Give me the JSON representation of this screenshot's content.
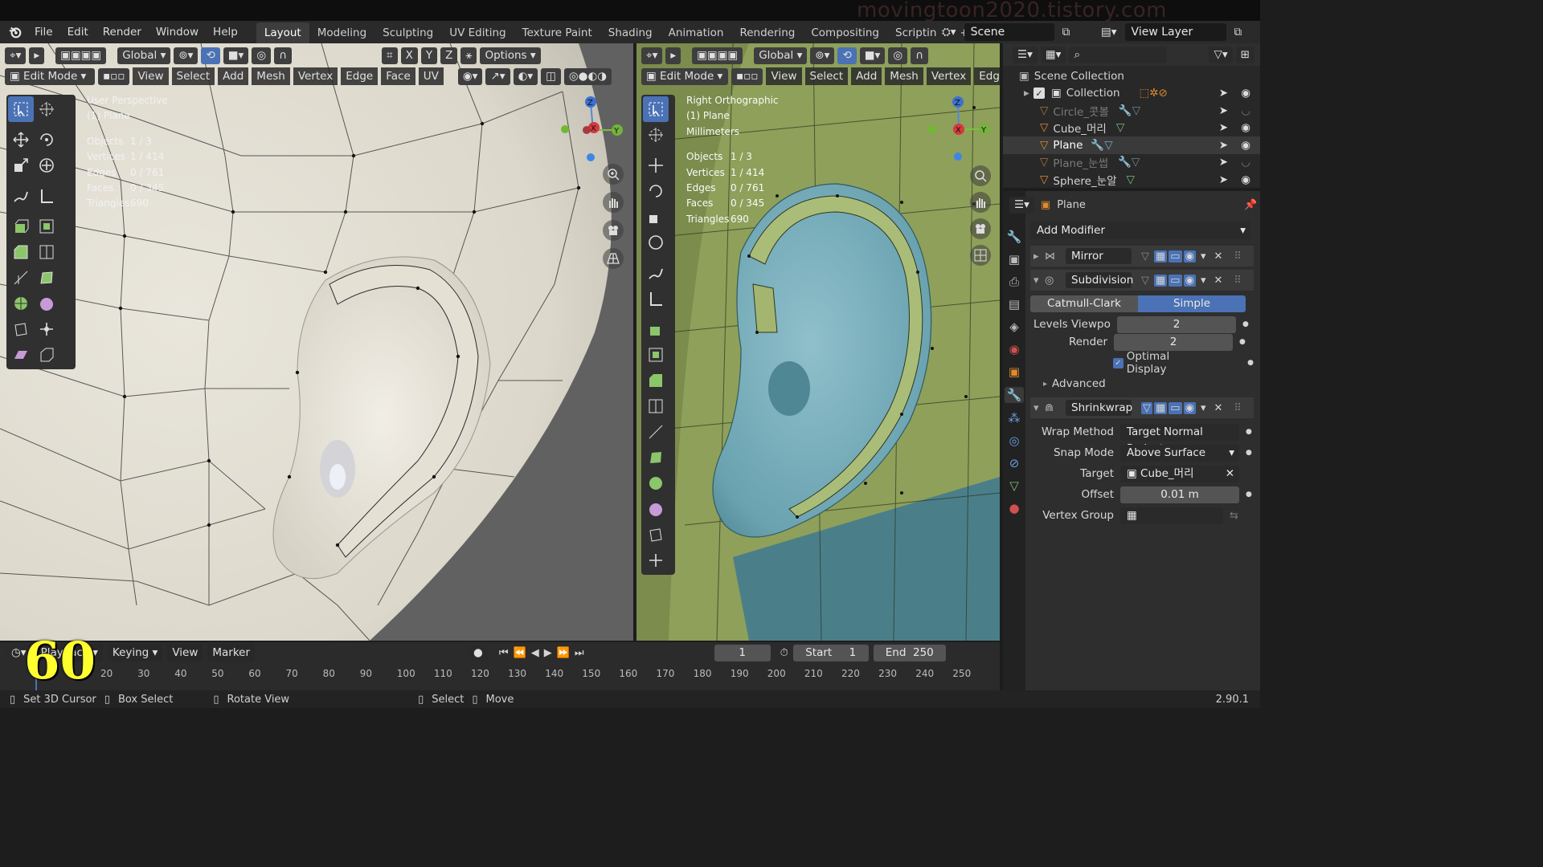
{
  "app": {
    "version": "2.90.1",
    "watermark": "movingtoon2020.tistory.com",
    "overlay_number": "60"
  },
  "menu": [
    "File",
    "Edit",
    "Render",
    "Window",
    "Help"
  ],
  "workspaces": {
    "active": "Layout",
    "tabs": [
      "Layout",
      "Modeling",
      "Sculpting",
      "UV Editing",
      "Texture Paint",
      "Shading",
      "Animation",
      "Rendering",
      "Compositing",
      "Scripting"
    ]
  },
  "scene": {
    "name": "Scene",
    "view_layer": "View Layer"
  },
  "left_viewport": {
    "mode": "Edit Mode",
    "orientation": "Global",
    "axes": [
      "X",
      "Y",
      "Z"
    ],
    "options": "Options",
    "menus": [
      "View",
      "Select",
      "Add",
      "Mesh",
      "Vertex",
      "Edge",
      "Face",
      "UV"
    ],
    "view_name": "User Perspective",
    "object_line": "(1) Plane",
    "stats": [
      {
        "label": "Objects",
        "value": "1 / 3"
      },
      {
        "label": "Vertices",
        "value": "1 / 414"
      },
      {
        "label": "Edges",
        "value": "0 / 761"
      },
      {
        "label": "Faces",
        "value": "0 / 345"
      },
      {
        "label": "Triangles",
        "value": "690"
      }
    ]
  },
  "right_viewport": {
    "mode": "Edit Mode",
    "orientation": "Global",
    "menus": [
      "View",
      "Select",
      "Add",
      "Mesh",
      "Vertex",
      "Edge"
    ],
    "view_name": "Right Orthographic",
    "object_line": "(1) Plane",
    "units": "Millimeters",
    "stats": [
      {
        "label": "Objects",
        "value": "1 / 3"
      },
      {
        "label": "Vertices",
        "value": "1 / 414"
      },
      {
        "label": "Edges",
        "value": "0 / 761"
      },
      {
        "label": "Faces",
        "value": "0 / 345"
      },
      {
        "label": "Triangles",
        "value": "690"
      }
    ]
  },
  "outliner": {
    "root": "Scene Collection",
    "collection": "Collection",
    "items": [
      {
        "name": "Circle_콧볼",
        "muted": true
      },
      {
        "name": "Cube_머리",
        "muted": false
      },
      {
        "name": "Plane",
        "muted": false
      },
      {
        "name": "Plane_눈썹",
        "muted": true
      },
      {
        "name": "Sphere_눈알",
        "muted": false
      }
    ]
  },
  "properties": {
    "object": "Plane",
    "add_modifier": "Add Modifier",
    "modifiers": {
      "mirror": "Mirror",
      "subdivision": {
        "name": "Subdivision",
        "type_options": [
          "Catmull-Clark",
          "Simple"
        ],
        "type_selected": "Simple",
        "levels_label": "Levels Viewpo",
        "levels_value": "2",
        "render_label": "Render",
        "render_value": "2",
        "optimal_display": "Optimal Display",
        "advanced": "Advanced"
      },
      "shrinkwrap": {
        "name": "Shrinkwrap",
        "wrap_label": "Wrap Method",
        "wrap_value": "Target Normal Project",
        "snap_label": "Snap Mode",
        "snap_value": "Above Surface",
        "target_label": "Target",
        "target_value": "Cube_머리",
        "offset_label": "Offset",
        "offset_value": "0.01 m",
        "vgroup_label": "Vertex Group"
      }
    }
  },
  "timeline": {
    "playback": "Playback",
    "keying": "Keying",
    "view": "View",
    "marker": "Marker",
    "current_frame": "1",
    "start_label": "Start",
    "start": "1",
    "end_label": "End",
    "end": "250",
    "ticks": [
      "20",
      "30",
      "40",
      "50",
      "60",
      "70",
      "80",
      "90",
      "100",
      "110",
      "120",
      "130",
      "140",
      "150",
      "160",
      "170",
      "180",
      "190",
      "200",
      "210",
      "220",
      "230",
      "240",
      "250"
    ]
  },
  "status": {
    "set_cursor": "Set 3D Cursor",
    "box_select": "Box Select",
    "rotate_view": "Rotate View",
    "select": "Select",
    "move": "Move"
  }
}
